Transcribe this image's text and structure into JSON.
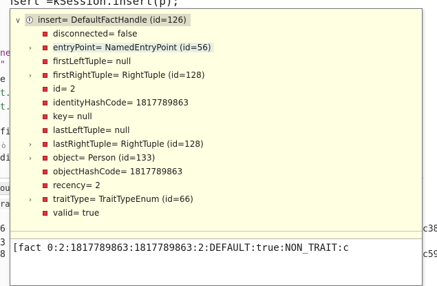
{
  "background": {
    "top_code": "insert =kSession.insert(p);",
    "left_fragments": [
      "e",
      "ne",
      "\"",
      "e",
      "t.",
      "t.",
      "fi",
      "ò",
      "di",
      "ou",
      "ra",
      "6",
      "3",
      "8"
    ],
    "right_fragments": [
      "c38",
      "c59"
    ]
  },
  "inspector": {
    "root": {
      "label": "insert= DefaultFactHandle  (id=126)"
    },
    "fields": [
      {
        "label": "disconnected= false",
        "expandable": false
      },
      {
        "label": "entryPoint= NamedEntryPoint  (id=56)",
        "expandable": true
      },
      {
        "label": "firstLeftTuple= null",
        "expandable": false
      },
      {
        "label": "firstRightTuple= RightTuple  (id=128)",
        "expandable": true
      },
      {
        "label": "id= 2",
        "expandable": false
      },
      {
        "label": "identityHashCode= 1817789863",
        "expandable": false
      },
      {
        "label": "key= null",
        "expandable": false
      },
      {
        "label": "lastLeftTuple= null",
        "expandable": false
      },
      {
        "label": "lastRightTuple= RightTuple  (id=128)",
        "expandable": true
      },
      {
        "label": "object= Person  (id=133)",
        "expandable": true
      },
      {
        "label": "objectHashCode= 1817789863",
        "expandable": false
      },
      {
        "label": "recency= 2",
        "expandable": false
      },
      {
        "label": "traitType= TraitTypeEnum  (id=66)",
        "expandable": true
      },
      {
        "label": "valid= true",
        "expandable": false
      }
    ],
    "detail": "[fact 0:2:1817789863:1817789863:2:DEFAULT:true:NON_TRAIT:c"
  }
}
